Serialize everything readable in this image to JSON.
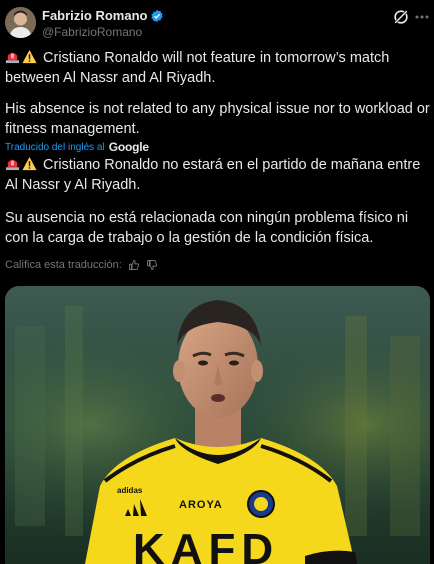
{
  "author": {
    "name": "Fabrizio Romano",
    "handle": "@FabrizioRomano",
    "verified_color": "#1d9bf0"
  },
  "header_icons": [
    "grok-icon",
    "more-icon"
  ],
  "tweet": {
    "original_p1": "Cristiano Ronaldo will not feature in tomorrow’s match between Al Nassr and Al Riyadh.",
    "original_p2": "His absence is not related to any physical issue nor to workload or fitness management.",
    "translated_by_label": "Traducido del inglés al",
    "translated_by_brand": "Google",
    "translated_p1": "Cristiano Ronaldo no estará en el partido de mañana entre Al Nassr y Al Riyadh.",
    "translated_p2": "Su ausencia no está relacionada con ningún problema físico ni con la carga de trabajo o la gestión de la condición física."
  },
  "rate_translation": {
    "label": "Califica esta traducción:"
  },
  "media": {
    "jersey_sponsor": "KAFD",
    "jersey_brand_left": "adidas",
    "jersey_brand_right": "AROYA",
    "colors": {
      "jersey": "#f5d81b",
      "trim": "#111111"
    }
  },
  "colors": {
    "background": "#000000",
    "text": "#e7e9ea",
    "muted": "#71767b",
    "link": "#1d9bf0"
  }
}
